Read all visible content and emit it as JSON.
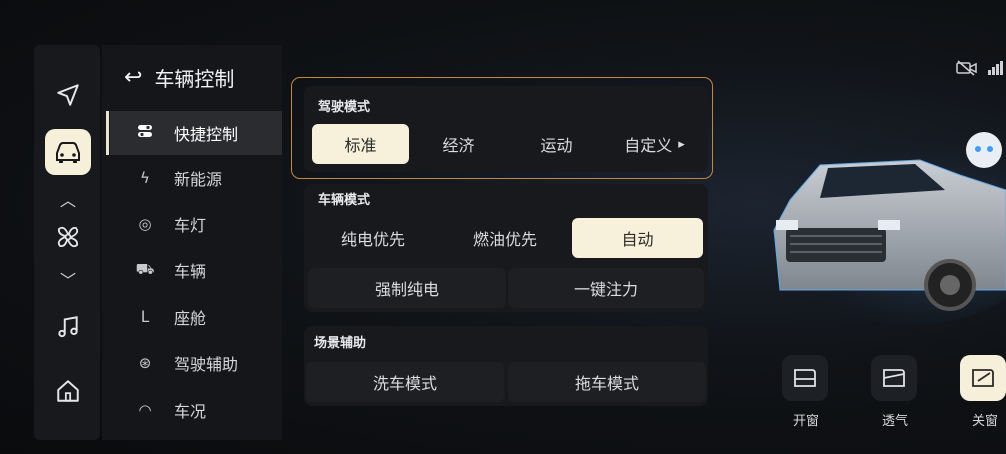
{
  "rail": {
    "icons": [
      "navigation-icon",
      "car-icon",
      "fan-icon",
      "music-icon",
      "home-icon"
    ]
  },
  "menu": {
    "back_label": "↩",
    "title": "车辆控制",
    "items": [
      {
        "label": "快捷控制",
        "icon": "toggle-icon",
        "active": true
      },
      {
        "label": "新能源",
        "icon": "bolt-icon"
      },
      {
        "label": "车灯",
        "icon": "light-icon"
      },
      {
        "label": "车辆",
        "icon": "car-front-icon"
      },
      {
        "label": "座舱",
        "icon": "seat-icon"
      },
      {
        "label": "驾驶辅助",
        "icon": "steering-wheel-icon"
      },
      {
        "label": "车况",
        "icon": "gauge-icon"
      }
    ]
  },
  "driving_mode": {
    "title": "驾驶模式",
    "options": [
      "标准",
      "经济",
      "运动",
      "自定义"
    ],
    "selected": "标准",
    "more_arrow": "▸"
  },
  "vehicle_mode": {
    "title": "车辆模式",
    "options": [
      "纯电优先",
      "燃油优先",
      "自动"
    ],
    "selected": "自动",
    "extra": [
      "强制纯电",
      "一键注力"
    ]
  },
  "scene_assist": {
    "title": "场景辅助",
    "options": [
      "洗车模式",
      "拖车模式"
    ]
  },
  "windows": {
    "items": [
      {
        "label": "开窗",
        "icon": "window-open-icon"
      },
      {
        "label": "透气",
        "icon": "window-vent-icon"
      },
      {
        "label": "关窗",
        "icon": "window-close-icon",
        "selected": true
      }
    ]
  },
  "colors": {
    "accent": "#f7f0da",
    "highlight_border": "#c5873a",
    "background": "#0c0d10"
  }
}
